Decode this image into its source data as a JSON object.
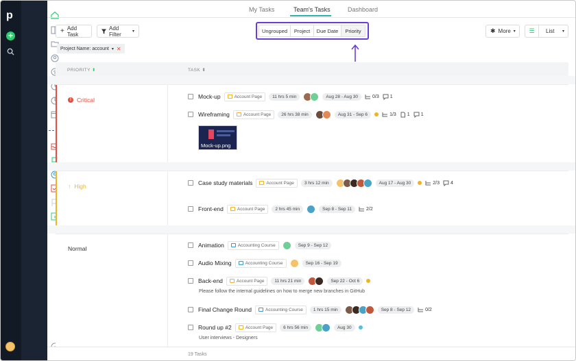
{
  "tabs": [
    "My Tasks",
    "Team's Tasks",
    "Dashboard"
  ],
  "toolbar": {
    "add_task": "Add Task",
    "add_filter": "Add Filter",
    "group_options": [
      "Ungrouped",
      "Project",
      "Due Date",
      "Priority"
    ],
    "more": "More",
    "view": "List"
  },
  "filter_chip": {
    "label": "Project Name:",
    "value": "account"
  },
  "columns": {
    "priority": "PRIORITY",
    "task": "TASK"
  },
  "colors": {
    "accent": "#26b5a8",
    "highlight": "#6a3cdc",
    "critical": "#e74c3c",
    "high": "#f0b323"
  },
  "groups": [
    {
      "name": "Critical",
      "color": "#e74c3c",
      "icon": "alert-circle-icon"
    },
    {
      "name": "High",
      "color": "#f0b323",
      "icon": "arrow-up-icon"
    },
    {
      "name": "Normal",
      "color": "#ffffff",
      "icon": ""
    }
  ],
  "tasks": [
    {
      "name": "Mock-up",
      "project": "Account Page",
      "time": "11 hrs 5 min",
      "date": "Aug 28 - Aug 30",
      "subtasks": "0/3",
      "comments": "1"
    },
    {
      "name": "Wireframing",
      "project": "Account Page",
      "time": "26 hrs 38 min",
      "date": "Aug 31 - Sep 6",
      "subtasks": "1/3",
      "files": "1",
      "comments": "1"
    },
    {
      "name": "Case study materials",
      "project": "Account Page",
      "time": "3 hrs 12 min",
      "date": "Aug 17 - Aug 30",
      "subtasks": "2/3",
      "comments": "4"
    },
    {
      "name": "Front-end",
      "project": "Account Page",
      "time": "2 hrs 45 min",
      "date": "Sep 8 - Sep 11",
      "subtasks": "2/2"
    },
    {
      "name": "Animation",
      "project": "Accounting Course",
      "date": "Sep 9 - Sep 12"
    },
    {
      "name": "Audio Mixing",
      "project": "Accounting Course",
      "date": "Sep 16 - Sep 19"
    },
    {
      "name": "Back-end",
      "project": "Account Page",
      "time": "11 hrs 21 min",
      "date": "Sep 22 - Oct 6",
      "description": "Please follow the internal guidelines on how to merge new branches in GitHub"
    },
    {
      "name": "Final Change Round",
      "project": "Accounting Course",
      "time": "1 hrs 15 min",
      "date": "Sep 8 - Sep 12",
      "subtasks": "0/2"
    },
    {
      "name": "Round up #2",
      "project": "Account Page",
      "time": "6 hrs 56 min",
      "date": "Aug 30",
      "description": "User interviews - Designers"
    }
  ],
  "attachment": "Mock-up.png",
  "footer": "19 Tasks"
}
